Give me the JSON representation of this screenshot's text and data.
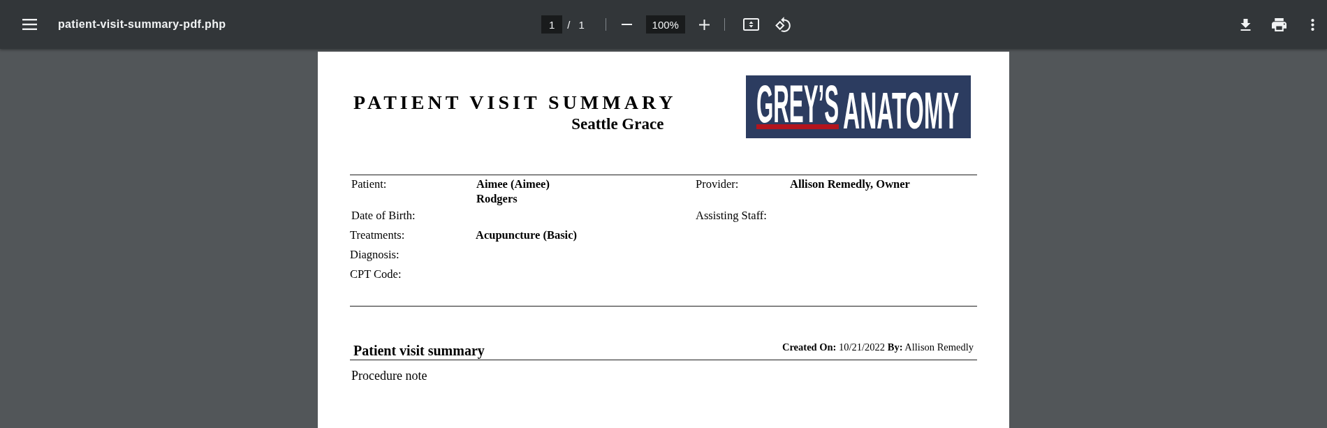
{
  "toolbar": {
    "filename": "patient-visit-summary-pdf.php",
    "page": {
      "current": "1",
      "separator": "/",
      "total": "1"
    },
    "zoom": "100%"
  },
  "document": {
    "title": "PATIENT VISIT SUMMARY",
    "subtitle": "Seattle Grace",
    "logo": {
      "primary": "GREY’S",
      "secondary": "ANATOMY"
    },
    "patient_fields": [
      {
        "label": "Patient:",
        "value": "Aimee (Aimee) Rodgers"
      },
      {
        "label": "Date of Birth:"
      }
    ],
    "staff_fields": [
      {
        "label": "Provider:",
        "value": "Allison Remedly, Owner"
      },
      {
        "label": "Assisting Staff:"
      }
    ],
    "clinical_fields": [
      {
        "label": "Treatments:",
        "value": "Acupuncture (Basic)"
      },
      {
        "label": "Diagnosis:"
      },
      {
        "label": "CPT Code:"
      }
    ],
    "section": {
      "title": "Patient visit summary",
      "meta": "**Created On:** 10/21/2022 **By:** Allison Remedly",
      "body": "Procedure note"
    }
  }
}
